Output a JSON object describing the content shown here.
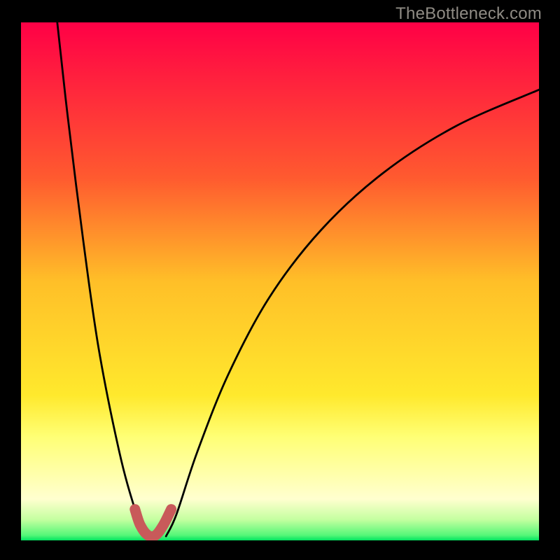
{
  "watermark": "TheBottleneck.com",
  "chart_data": {
    "type": "line",
    "title": "",
    "xlabel": "",
    "ylabel": "",
    "xlim": [
      0,
      100
    ],
    "ylim": [
      0,
      100
    ],
    "background": {
      "gradient_direction": "vertical",
      "stops": [
        {
          "y": 0,
          "color": "#ff0046"
        },
        {
          "y": 30,
          "color": "#ff5a2f"
        },
        {
          "y": 50,
          "color": "#ffbf28"
        },
        {
          "y": 72,
          "color": "#ffe92d"
        },
        {
          "y": 80,
          "color": "#ffff75"
        },
        {
          "y": 92,
          "color": "#ffffcf"
        },
        {
          "y": 96,
          "color": "#c4ffa0"
        },
        {
          "y": 99,
          "color": "#55f778"
        },
        {
          "y": 100,
          "color": "#00e25f"
        }
      ]
    },
    "series": [
      {
        "name": "left-branch",
        "style": "curve-black",
        "points": [
          {
            "x": 7.0,
            "y": 100.0
          },
          {
            "x": 9.0,
            "y": 82.0
          },
          {
            "x": 12.0,
            "y": 58.0
          },
          {
            "x": 15.0,
            "y": 37.0
          },
          {
            "x": 19.0,
            "y": 17.0
          },
          {
            "x": 22.0,
            "y": 6.0
          },
          {
            "x": 24.0,
            "y": 0.8
          }
        ]
      },
      {
        "name": "right-branch",
        "style": "curve-black",
        "points": [
          {
            "x": 28.0,
            "y": 0.8
          },
          {
            "x": 30.0,
            "y": 5.0
          },
          {
            "x": 34.0,
            "y": 17.0
          },
          {
            "x": 40.0,
            "y": 32.0
          },
          {
            "x": 48.0,
            "y": 47.0
          },
          {
            "x": 58.0,
            "y": 60.0
          },
          {
            "x": 70.0,
            "y": 71.0
          },
          {
            "x": 84.0,
            "y": 80.0
          },
          {
            "x": 100.0,
            "y": 87.0
          }
        ]
      },
      {
        "name": "trough-highlight",
        "style": "trough-pink",
        "points": [
          {
            "x": 22.0,
            "y": 6.0
          },
          {
            "x": 23.0,
            "y": 3.0
          },
          {
            "x": 24.5,
            "y": 1.0
          },
          {
            "x": 26.0,
            "y": 1.0
          },
          {
            "x": 27.5,
            "y": 3.0
          },
          {
            "x": 29.0,
            "y": 6.0
          }
        ]
      }
    ],
    "minimum": {
      "x": 25.5,
      "y": 0.8
    }
  }
}
